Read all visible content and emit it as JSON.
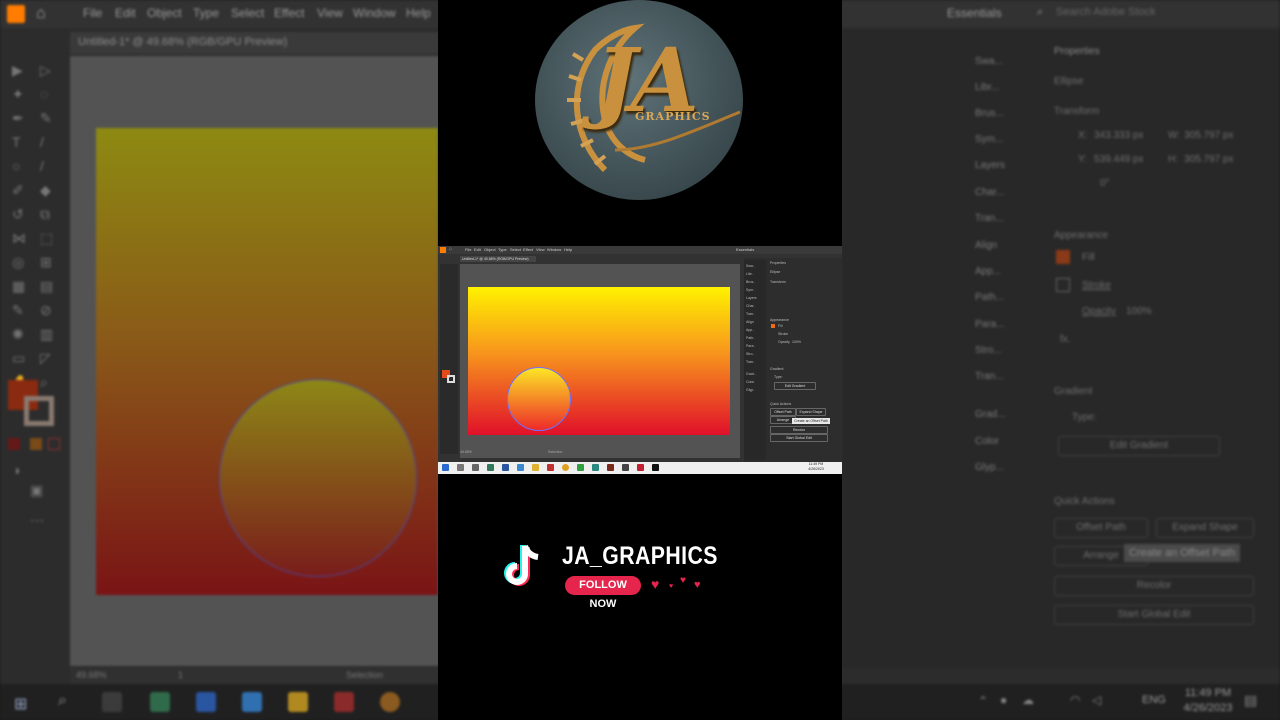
{
  "background": {
    "app_menu": [
      "File",
      "Edit",
      "Object",
      "Type",
      "Select",
      "Effect",
      "View",
      "Window",
      "Help"
    ],
    "workspace": "Essentials",
    "search_placeholder": "Search Adobe Stock",
    "document_tab": "Untitled-1* @ 49.68% (RGB/GPU Preview)",
    "zoom": "49.68%",
    "artboard_num": "1",
    "status_tool": "Selection",
    "panels_dock": [
      "Swa...",
      "Libr...",
      "Brus...",
      "Sym...",
      "Layers",
      "Char...",
      "Tran...",
      "Align",
      "App...",
      "Path...",
      "Para...",
      "Stro...",
      "Tran...",
      "Grad...",
      "Color",
      "Glyp..."
    ],
    "properties": {
      "title": "Properties",
      "object": "Ellipse",
      "transform_label": "Transform",
      "x_label": "X:",
      "x": "343.333 px",
      "y_label": "Y:",
      "y": "539.449 px",
      "w_label": "W:",
      "w": "305.797 px",
      "h_label": "H:",
      "h": "305.797 px",
      "angle": "0°",
      "appearance_label": "Appearance",
      "fill_label": "Fill",
      "stroke_label": "Stroke",
      "opacity_label": "Opacity",
      "opacity": "100%",
      "fx_label": "fx.",
      "gradient_label": "Gradient",
      "type_label": "Type:",
      "edit_gradient": "Edit Gradient",
      "quick_actions": "Quick Actions",
      "offset_path": "Offset Path",
      "expand_shape": "Expand Shape",
      "arrange": "Arrange",
      "recolor": "Recolor",
      "start_global_edit": "Start Global Edit",
      "tooltip": "Create an Offset Path"
    },
    "clock_time": "11:49 PM",
    "clock_date": "4/26/2023",
    "language": "ENG"
  },
  "inner_screenshot": {
    "menu": [
      "File",
      "Edit",
      "Object",
      "Type",
      "Select",
      "Effect",
      "View",
      "Window",
      "Help"
    ],
    "workspace": "Essentials",
    "tab": "Untitled-1* @ 49.68% (RGB/GPU Preview)",
    "zoom": "49.68%",
    "status": "Selection",
    "panels": [
      "Swa..",
      "Libr..",
      "Brus..",
      "Sym..",
      "Layers",
      "Char..",
      "Tran..",
      "Align",
      "App..",
      "Path..",
      "Para..",
      "Stro..",
      "Tran..",
      "Grad..",
      "Color",
      "Glyp.."
    ],
    "properties": {
      "title": "Properties",
      "object": "Ellipse",
      "transform": "Transform",
      "appearance": "Appearance",
      "fill": "Fill",
      "stroke": "Stroke",
      "opacity": "Opacity",
      "opacity_val": "100%",
      "gradient": "Gradient",
      "type": "Type:",
      "edit_gradient": "Edit Gradient",
      "quick_actions": "Quick Actions",
      "offset_path": "Offset Path",
      "expand_shape": "Expand Shape",
      "arrange": "Arrange",
      "recolor": "Recolor",
      "start_global_edit": "Start Global Edit",
      "tooltip": "Create an Offset Path"
    },
    "clock_time": "11:49 PM",
    "clock_date": "4/26/2023"
  },
  "logo": {
    "letters": "JA",
    "sub": "GRAPHICS"
  },
  "promo": {
    "brand": "JA_GRAPHICS",
    "follow_label": "FOLLOW NOW"
  },
  "colors": {
    "follow_button": "#e6254d",
    "logo_gold": "#c9913e",
    "gradient_top": "#fff200",
    "gradient_bottom": "#e0102a"
  }
}
